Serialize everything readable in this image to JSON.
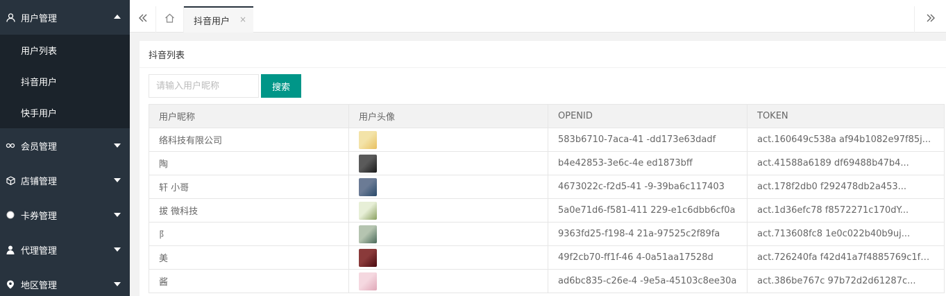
{
  "sidebar": {
    "groups": [
      {
        "label": "用户管理",
        "icon": "user-icon",
        "open": true,
        "items": [
          {
            "label": "用户列表"
          },
          {
            "label": "抖音用户"
          },
          {
            "label": "快手用户"
          }
        ]
      },
      {
        "label": "会员管理",
        "icon": "link-icon"
      },
      {
        "label": "店铺管理",
        "icon": "cube-icon"
      },
      {
        "label": "卡券管理",
        "icon": "circle-icon"
      },
      {
        "label": "代理管理",
        "icon": "person-icon"
      },
      {
        "label": "地区管理",
        "icon": "location-icon"
      }
    ]
  },
  "tabs": {
    "active_label": "抖音用户",
    "close": "×"
  },
  "card": {
    "title": "抖音列表"
  },
  "search": {
    "placeholder": "请输入用户昵称",
    "button_label": "搜索",
    "button_color": "#009688"
  },
  "table": {
    "headers": [
      "用户昵称",
      "用户头像",
      "OPENID",
      "TOKEN"
    ],
    "rows": [
      {
        "nickname": "络科技有限公司",
        "avatar_colors": [
          "#f3e3a8",
          "#e8c060"
        ],
        "openid": "583b6710-7aca-41 -dd173e63dadf",
        "token": "act.160649c538a af94b1082e97f85j..."
      },
      {
        "nickname": "陶",
        "avatar_colors": [
          "#5a5a5a",
          "#1a1a1a"
        ],
        "openid": "b4e42853-3e6c-4e ed1873bff",
        "token": "act.41588a6189 df69488b47b4..."
      },
      {
        "nickname": "轩 小哥",
        "avatar_colors": [
          "#6b7b95",
          "#2a4a6a"
        ],
        "openid": "4673022c-f2d5-41 -9-39ba6c117403",
        "token": "act.178f2db0 f292478db2a453..."
      },
      {
        "nickname": "拔 微科技",
        "avatar_colors": [
          "#e7efd7",
          "#8aa060"
        ],
        "openid": "5a0e71d6-f581-411 229-e1c6dbb6cf0a",
        "token": "act.1d36efc78 f8572271c170dY..."
      },
      {
        "nickname": "阝",
        "avatar_colors": [
          "#b5c4b0",
          "#4a6a5a"
        ],
        "openid": "9363fd25-f198-4 21a-97525c2f89fa",
        "token": "act.713608fc8 1e0c022b40b9uj..."
      },
      {
        "nickname": "美",
        "avatar_colors": [
          "#8a3a3a",
          "#4a0a10"
        ],
        "openid": "49f2cb70-ff1f-46 4-0a51aa17528d",
        "token": "act.726240fa f42d41a7f4885769c1fU..."
      },
      {
        "nickname": "酱",
        "avatar_colors": [
          "#f5d8e0",
          "#e0a8b8"
        ],
        "openid": "ad6bc835-c26e-4 -9e5a-45103c8ee30a",
        "token": "act.386be767c 97b72d2d61287c..."
      }
    ]
  }
}
